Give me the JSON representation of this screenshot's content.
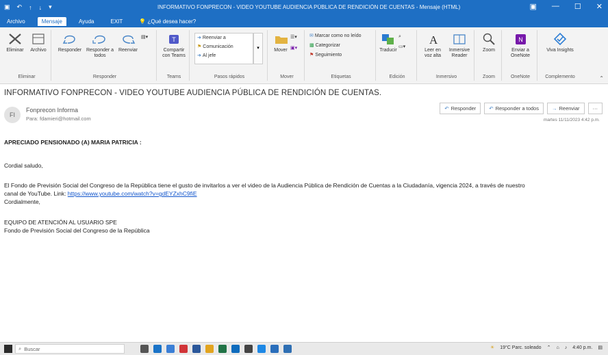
{
  "window": {
    "title": "INFORMATIVO FONPRECON - VIDEO YOUTUBE AUDIENCIA PÚBLICA DE RENDICIÓN DE CUENTAS - Mensaje (HTML)",
    "controls": {
      "min": "—",
      "max": "☐",
      "close": "✕"
    }
  },
  "tabs": [
    {
      "label": "Archivo"
    },
    {
      "label": "Mensaje",
      "active": true
    },
    {
      "label": "Ayuda"
    },
    {
      "label": "EXIT"
    },
    {
      "label": "¿Qué desea hacer?"
    }
  ],
  "ribbon": {
    "groups": {
      "eliminar": {
        "label": "Eliminar",
        "items": [
          "Eliminar",
          "Archivo"
        ]
      },
      "responder": {
        "label": "Responder",
        "items": [
          "Responder",
          "Responder a todos",
          "Reenviar"
        ]
      },
      "teams": {
        "label": "Teams",
        "items": [
          "Compartir con Teams"
        ]
      },
      "pasos": {
        "label": "Pasos rápidos",
        "items": [
          "Reenviar a",
          "Comunicación",
          "Al jefe"
        ]
      },
      "mover": {
        "label": "Mover",
        "items": [
          "Mover"
        ]
      },
      "etiquetas": {
        "label": "Etiquetas",
        "items": [
          "Marcar como no leído",
          "Categorizar",
          "Seguimiento"
        ]
      },
      "edicion": {
        "label": "Edición",
        "items": [
          "Traducir"
        ]
      },
      "inmersivo": {
        "label": "Inmersivo",
        "items": [
          "Leer en voz alta",
          "Inmersive Reader"
        ]
      },
      "zoom": {
        "label": "Zoom",
        "items": [
          "Zoom"
        ]
      },
      "onenote": {
        "label": "OneNote",
        "items": [
          "Enviar a OneNote"
        ]
      },
      "complementos": {
        "label": "Complemento",
        "items": [
          "Viva Insights"
        ]
      }
    }
  },
  "email": {
    "subject": "INFORMATIVO FONPRECON - VIDEO YOUTUBE AUDIENCIA PÚBLICA DE RENDICIÓN DE CUENTAS.",
    "avatar_initials": "FI",
    "sender": "Fonprecon Informa",
    "to": "Para: fdamieri@hotmail.com",
    "actions": {
      "reply": "Responder",
      "reply_all": "Responder a todos",
      "forward": "Reenviar",
      "more": "···"
    },
    "date": "martes 11/11/2023 4:42 p.m.",
    "greeting": "APRECIADO PENSIONADO (A) MARIA PATRICIA :",
    "salutation": "Cordial saludo,",
    "para1_line1": "El Fondo de Previsión Social del Congreso de la República tiene el gusto de invitarlos a ver el video de la Audiencia Pública de Rendición de Cuentas a la Ciudadanía, vigencia 2024, a través de nuestro",
    "para1_line2_prefix": "canal de YouTube. Link: ",
    "link": "https://www.youtube.com/watch?v=gdEYZxhC9fiE",
    "closing": "Cordialmente,",
    "sig1": "EQUIPO DE ATENCIÓN AL USUARIO SPE",
    "sig2": "Fondo de Previsión Social del Congreso de la República"
  },
  "taskbar": {
    "search_placeholder": "Buscar",
    "weather": "19°C  Parc. soleado",
    "time": "4:40 p.m."
  }
}
